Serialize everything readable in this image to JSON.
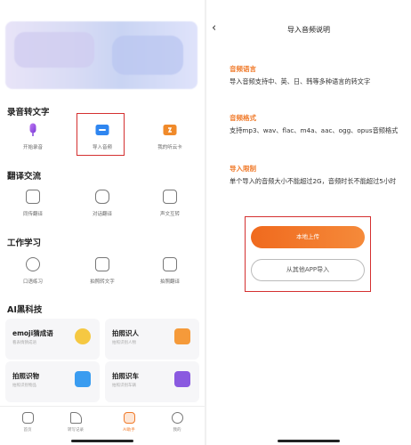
{
  "left": {
    "section_recording": "录音转文字",
    "recording_items": [
      {
        "label": "开始录音",
        "icon": "microphone-icon"
      },
      {
        "label": "导入音频",
        "icon": "import-audio-icon"
      },
      {
        "label": "我的听云卡",
        "icon": "card-icon"
      }
    ],
    "section_translate": "翻译交流",
    "translate_items": [
      {
        "label": "同传翻译",
        "icon": "translate-icon"
      },
      {
        "label": "对话翻译",
        "icon": "chat-icon"
      },
      {
        "label": "声文互转",
        "icon": "convert-icon"
      }
    ],
    "section_study": "工作学习",
    "study_items": [
      {
        "label": "口语练习",
        "icon": "speak-icon"
      },
      {
        "label": "拍照转文字",
        "icon": "scan-icon"
      },
      {
        "label": "拍照翻译",
        "icon": "photo-icon"
      }
    ],
    "section_ai": "AI黑科技",
    "ai_cards": [
      {
        "title": "emoji猜成语",
        "subtitle": "看表情猜成语",
        "color": "#f5c842"
      },
      {
        "title": "拍照识人",
        "subtitle": "拍照识别人物",
        "color": "#f59a3a"
      },
      {
        "title": "拍照识物",
        "subtitle": "拍照识别物品",
        "color": "#3a9cf0"
      },
      {
        "title": "拍照识车",
        "subtitle": "拍照识别车辆",
        "color": "#8a5ae0"
      }
    ],
    "tabs": [
      {
        "label": "首页",
        "icon": "home-icon"
      },
      {
        "label": "转写记录",
        "icon": "edit-icon"
      },
      {
        "label": "AI助手",
        "icon": "assistant-icon"
      },
      {
        "label": "我的",
        "icon": "profile-icon"
      }
    ]
  },
  "right": {
    "back_glyph": "‹",
    "title": "导入音频说明",
    "sections": [
      {
        "heading": "音频语言",
        "text": "导入音频支持中、英、日、韩等多种语言的转文字"
      },
      {
        "heading": "音频格式",
        "text": "支持mp3、wav、flac、m4a、aac、ogg、opus音频格式"
      },
      {
        "heading": "导入限制",
        "text": "单个导入的音频大小不能超过2G，音频时长不能超过5小时"
      }
    ],
    "primary_button": "本地上传",
    "secondary_button": "从其他APP导入"
  },
  "colors": {
    "accent": "#f07a2a",
    "highlight": "#d43030"
  }
}
